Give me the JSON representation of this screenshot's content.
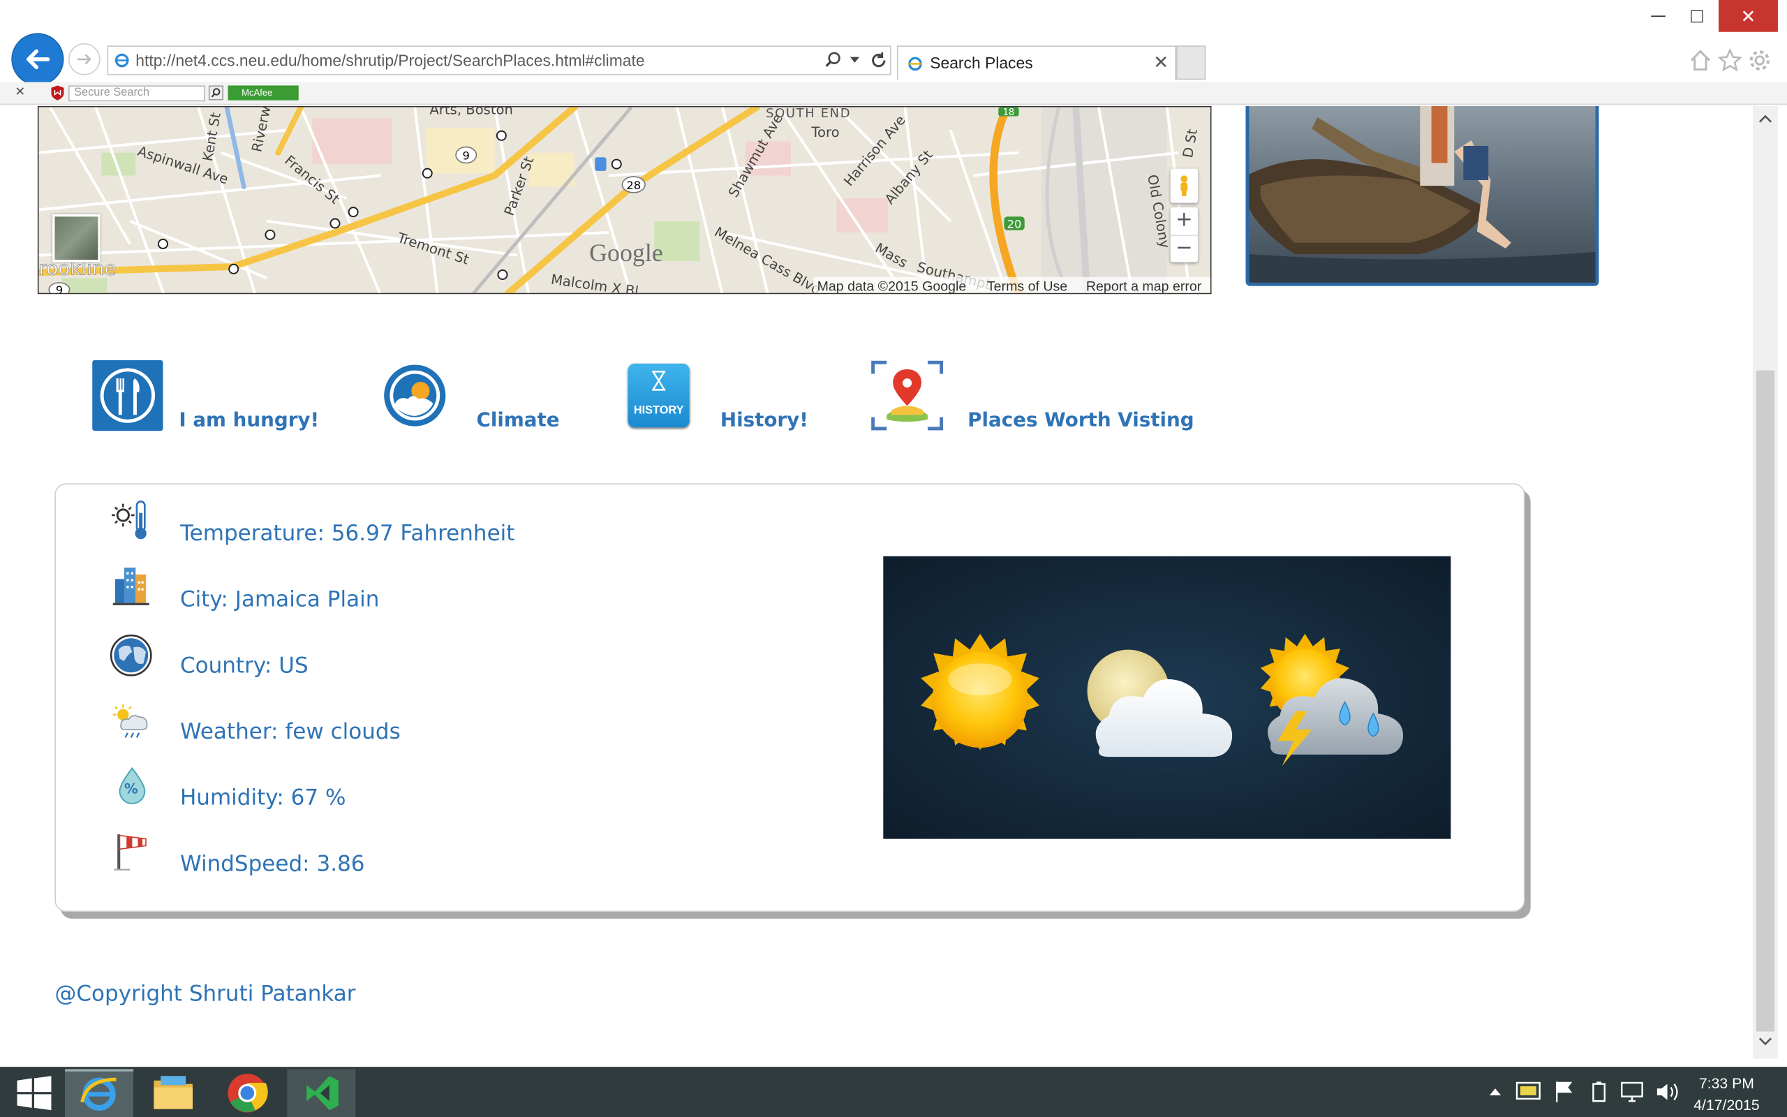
{
  "browser": {
    "address": "http://net4.ccs.neu.edu/home/shrutip/Project/SearchPlaces.html#climate",
    "tab_title": "Search Places",
    "search_placeholder": "Secure Search",
    "mcafee_label": "McAfee"
  },
  "map": {
    "labels": [
      "Arts, Boston",
      "SOUTH END",
      "Toro",
      "Aspinwall Ave",
      "Kent St",
      "Riverw",
      "Francis St",
      "Parker St",
      "Tremont St",
      "Shawmut Ave",
      "Harrison Ave",
      "Albany St",
      "Melnea Cass Blvd",
      "Malcolm X Bl",
      "Mass",
      "Southampt",
      "Old Colony",
      "D St",
      "rookline"
    ],
    "route_numbers": [
      "9",
      "28",
      "20",
      "18",
      "9"
    ],
    "logo": "Google",
    "attribution": "Map data ©2015 Google",
    "terms": "Terms of Use",
    "report": "Report a map error",
    "zoom_in": "+",
    "zoom_out": "−"
  },
  "nav": [
    {
      "label": "I am hungry!",
      "icon": "fork-knife-icon"
    },
    {
      "label": "Climate",
      "icon": "climate-icon"
    },
    {
      "label": "History!",
      "icon": "history-icon",
      "icon_text": "HISTORY"
    },
    {
      "label": "Places Worth Visting",
      "icon": "map-pin-icon"
    }
  ],
  "weather": {
    "temperature": "Temperature: 56.97 Fahrenheit",
    "city": "City: Jamaica Plain",
    "country": "Country: US",
    "weather": "Weather: few clouds",
    "humidity": "Humidity: 67 %",
    "windspeed": "WindSpeed: 3.86",
    "humidity_icon_text": "%"
  },
  "footer": {
    "copyright": "@Copyright Shruti Patankar"
  },
  "taskbar": {
    "time": "7:33 PM",
    "date": "4/17/2015"
  },
  "colors": {
    "accent": "#2e73b6",
    "ie_blue": "#1e7ad2",
    "close_red": "#c8352e"
  }
}
